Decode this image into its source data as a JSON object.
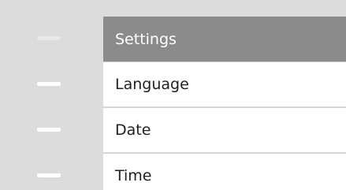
{
  "sidebar": {
    "dashes": [
      {
        "name": "settings-marker",
        "state": "muted"
      },
      {
        "name": "language-marker",
        "state": "active"
      },
      {
        "name": "date-marker",
        "state": "active"
      },
      {
        "name": "time-marker",
        "state": "active"
      }
    ]
  },
  "menu": {
    "title": "Settings",
    "items": [
      {
        "label": "Language"
      },
      {
        "label": "Date"
      },
      {
        "label": "Time"
      }
    ]
  }
}
